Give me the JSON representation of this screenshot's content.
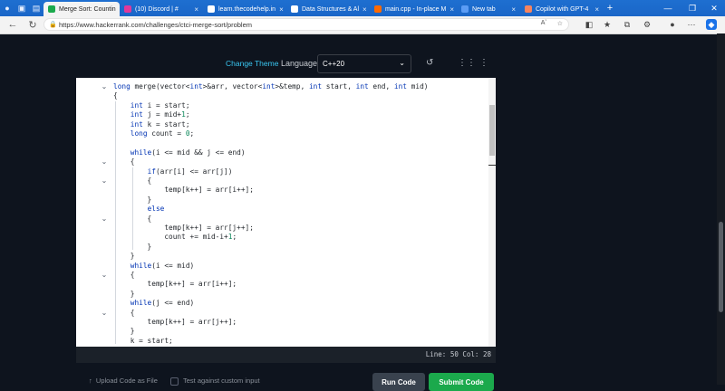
{
  "browser": {
    "tabs": [
      {
        "title": "Merge Sort: Countin",
        "fav_color": "#1ba94c",
        "active": true
      },
      {
        "title": "(10) Discord | #",
        "fav_color": "#e0399b",
        "active": false
      },
      {
        "title": "learn.thecodehelp.in",
        "fav_color": "#ffffff",
        "active": false
      },
      {
        "title": "Data Structures & Al",
        "fav_color": "#ffffff",
        "active": false
      },
      {
        "title": "main.cpp - In-place M",
        "fav_color": "#ff6a00",
        "active": false
      },
      {
        "title": "New tab",
        "fav_color": "#5b9cf5",
        "active": false
      },
      {
        "title": "Copilot with GPT-4",
        "fav_color": "#f7845e",
        "active": false
      }
    ],
    "new_tab_glyph": "+",
    "url": "https://www.hackerrank.com/challenges/ctci-merge-sort/problem",
    "reader_label": "Aʼ"
  },
  "toolbar": {
    "change_theme": "Change Theme",
    "language_label": "Language",
    "language_value": "C++20"
  },
  "code_lines": [
    {
      "html": "<span class=\"kw\">long</span> merge(vector&lt;<span class=\"kw\">int</span>&gt;&amp;arr, vector&lt;<span class=\"kw\">int</span>&gt;&amp;temp, <span class=\"kw\">int</span> start, <span class=\"kw\">int</span> end, <span class=\"kw\">int</span> mid)",
      "fold": true
    },
    {
      "html": "{",
      "fold": false
    },
    {
      "html": "    <span class=\"kw\">int</span> i = start;",
      "fold": false
    },
    {
      "html": "    <span class=\"kw\">int</span> j = mid+<span class=\"num\">1</span>;",
      "fold": false
    },
    {
      "html": "    <span class=\"kw\">int</span> k = start;",
      "fold": false
    },
    {
      "html": "    <span class=\"kw\">long</span> count = <span class=\"num\">0</span>;",
      "fold": false
    },
    {
      "html": "",
      "fold": false
    },
    {
      "html": "    <span class=\"kw\">while</span>(i &lt;= mid &amp;&amp; j &lt;= end)",
      "fold": false
    },
    {
      "html": "    {",
      "fold": true
    },
    {
      "html": "        <span class=\"kw\">if</span>(arr[i] &lt;= arr[j])",
      "fold": false
    },
    {
      "html": "        {",
      "fold": true
    },
    {
      "html": "            temp[k++] = arr[i++];",
      "fold": false
    },
    {
      "html": "        }",
      "fold": false
    },
    {
      "html": "        <span class=\"kw\">else</span>",
      "fold": false
    },
    {
      "html": "        {",
      "fold": true
    },
    {
      "html": "            temp[k++] = arr[j++];",
      "fold": false
    },
    {
      "html": "            count += mid-i+<span class=\"num\">1</span>;",
      "fold": false
    },
    {
      "html": "        }",
      "fold": false
    },
    {
      "html": "    }",
      "fold": false
    },
    {
      "html": "    <span class=\"kw\">while</span>(i &lt;= mid)",
      "fold": false
    },
    {
      "html": "    {",
      "fold": true
    },
    {
      "html": "        temp[k++] = arr[i++];",
      "fold": false
    },
    {
      "html": "    }",
      "fold": false
    },
    {
      "html": "    <span class=\"kw\">while</span>(j &lt;= end)",
      "fold": false
    },
    {
      "html": "    {",
      "fold": true
    },
    {
      "html": "        temp[k++] = arr[j++];",
      "fold": false
    },
    {
      "html": "    }",
      "fold": false
    },
    {
      "html": "    k = start;",
      "fold": false
    }
  ],
  "status": {
    "text": "Line: 50 Col: 28"
  },
  "actions": {
    "upload_label": "Upload Code as File",
    "custom_input_label": "Test against custom input",
    "run_label": "Run Code",
    "submit_label": "Submit Code"
  }
}
